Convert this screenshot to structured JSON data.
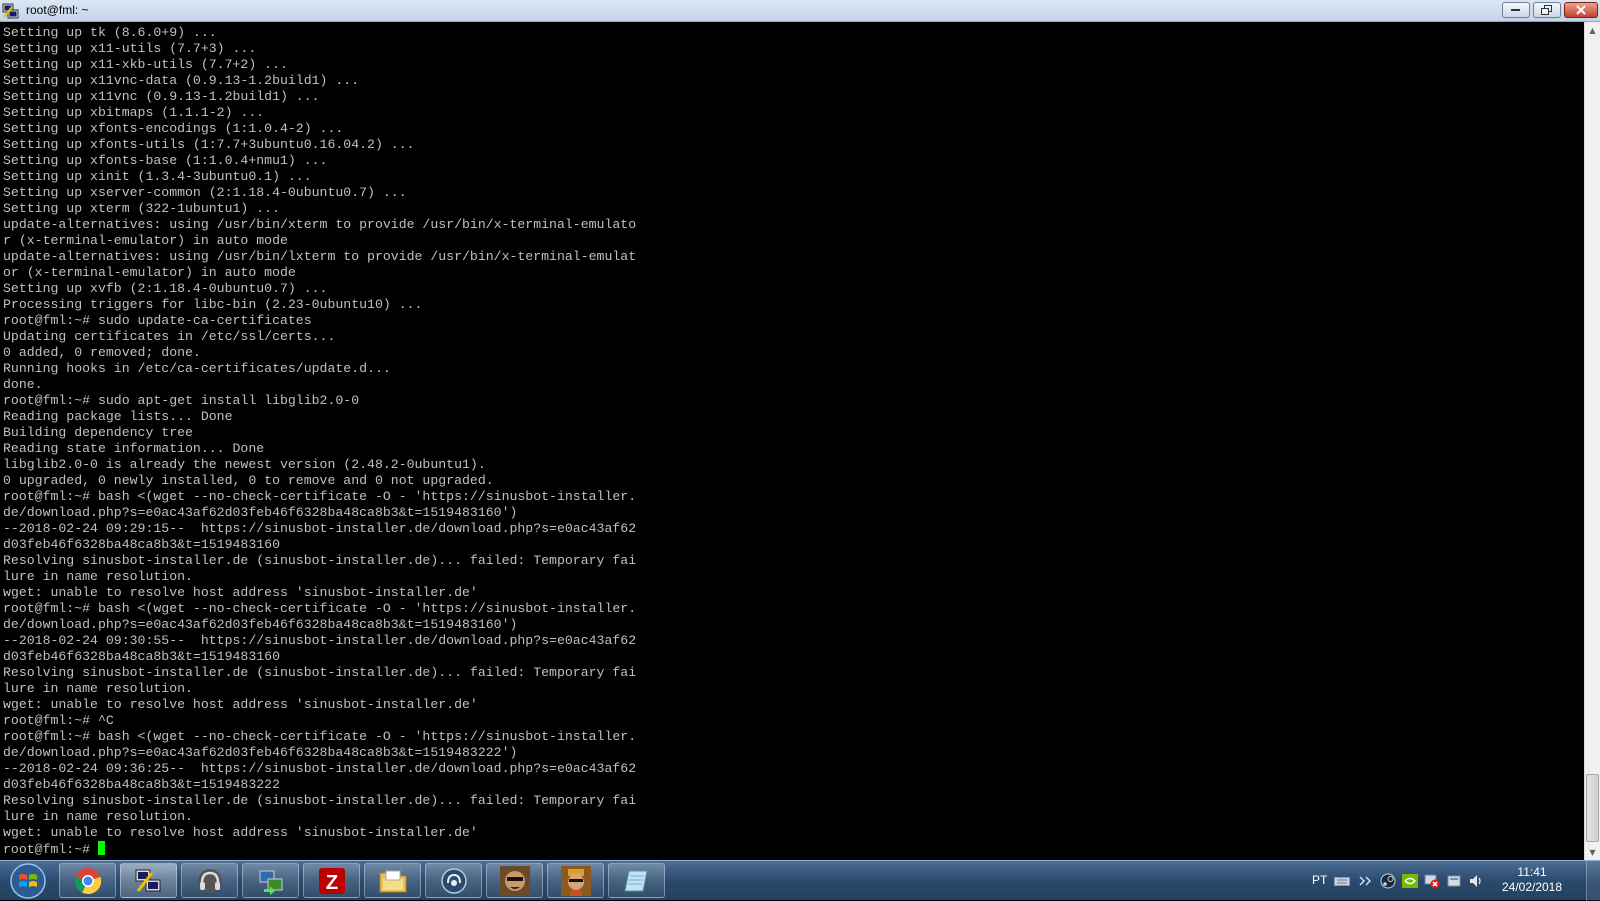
{
  "window": {
    "title": "root@fml: ~"
  },
  "terminal": {
    "lines": [
      "Setting up tk (8.6.0+9) ...",
      "Setting up x11-utils (7.7+3) ...",
      "Setting up x11-xkb-utils (7.7+2) ...",
      "Setting up x11vnc-data (0.9.13-1.2build1) ...",
      "Setting up x11vnc (0.9.13-1.2build1) ...",
      "Setting up xbitmaps (1.1.1-2) ...",
      "Setting up xfonts-encodings (1:1.0.4-2) ...",
      "Setting up xfonts-utils (1:7.7+3ubuntu0.16.04.2) ...",
      "Setting up xfonts-base (1:1.0.4+nmu1) ...",
      "Setting up xinit (1.3.4-3ubuntu0.1) ...",
      "Setting up xserver-common (2:1.18.4-0ubuntu0.7) ...",
      "Setting up xterm (322-1ubuntu1) ...",
      "update-alternatives: using /usr/bin/xterm to provide /usr/bin/x-terminal-emulato",
      "r (x-terminal-emulator) in auto mode",
      "update-alternatives: using /usr/bin/lxterm to provide /usr/bin/x-terminal-emulat",
      "or (x-terminal-emulator) in auto mode",
      "Setting up xvfb (2:1.18.4-0ubuntu0.7) ...",
      "Processing triggers for libc-bin (2.23-0ubuntu10) ...",
      "root@fml:~# sudo update-ca-certificates",
      "Updating certificates in /etc/ssl/certs...",
      "0 added, 0 removed; done.",
      "Running hooks in /etc/ca-certificates/update.d...",
      "done.",
      "root@fml:~# sudo apt-get install libglib2.0-0",
      "Reading package lists... Done",
      "Building dependency tree",
      "Reading state information... Done",
      "libglib2.0-0 is already the newest version (2.48.2-0ubuntu1).",
      "0 upgraded, 0 newly installed, 0 to remove and 0 not upgraded.",
      "root@fml:~# bash <(wget --no-check-certificate -O - 'https://sinusbot-installer.",
      "de/download.php?s=e0ac43af62d03feb46f6328ba48ca8b3&t=1519483160')",
      "--2018-02-24 09:29:15--  https://sinusbot-installer.de/download.php?s=e0ac43af62",
      "d03feb46f6328ba48ca8b3&t=1519483160",
      "Resolving sinusbot-installer.de (sinusbot-installer.de)... failed: Temporary fai",
      "lure in name resolution.",
      "wget: unable to resolve host address 'sinusbot-installer.de'",
      "root@fml:~# bash <(wget --no-check-certificate -O - 'https://sinusbot-installer.",
      "de/download.php?s=e0ac43af62d03feb46f6328ba48ca8b3&t=1519483160')",
      "--2018-02-24 09:30:55--  https://sinusbot-installer.de/download.php?s=e0ac43af62",
      "d03feb46f6328ba48ca8b3&t=1519483160",
      "Resolving sinusbot-installer.de (sinusbot-installer.de)... failed: Temporary fai",
      "lure in name resolution.",
      "wget: unable to resolve host address 'sinusbot-installer.de'",
      "root@fml:~# ^C",
      "root@fml:~# bash <(wget --no-check-certificate -O - 'https://sinusbot-installer.",
      "de/download.php?s=e0ac43af62d03feb46f6328ba48ca8b3&t=1519483222')",
      "--2018-02-24 09:36:25--  https://sinusbot-installer.de/download.php?s=e0ac43af62",
      "d03feb46f6328ba48ca8b3&t=1519483222",
      "Resolving sinusbot-installer.de (sinusbot-installer.de)... failed: Temporary fai",
      "lure in name resolution.",
      "wget: unable to resolve host address 'sinusbot-installer.de'"
    ],
    "prompt": "root@fml:~# ",
    "text_color": "#c0c0c0",
    "cursor_color": "#00ff00"
  },
  "taskbar": {
    "buttons": [
      {
        "icon": "start-orb-icon"
      },
      {
        "icon": "chrome-icon"
      },
      {
        "icon": "putty-icon"
      },
      {
        "icon": "headset-icon"
      },
      {
        "icon": "file-transfer-icon"
      },
      {
        "icon": "filezilla-icon"
      },
      {
        "icon": "folder-icon"
      },
      {
        "icon": "teamspeak-icon"
      },
      {
        "icon": "game-character-icon"
      },
      {
        "icon": "game-character-icon"
      },
      {
        "icon": "notepad-icon"
      }
    ],
    "tray": {
      "language": "PT",
      "icons": [
        "keyboard-icon",
        "wireless-icon",
        "steam-icon",
        "nvidia-icon",
        "network-error-icon",
        "action-center-icon",
        "volume-icon"
      ],
      "time": "11:41",
      "date": "24/02/2018"
    }
  }
}
